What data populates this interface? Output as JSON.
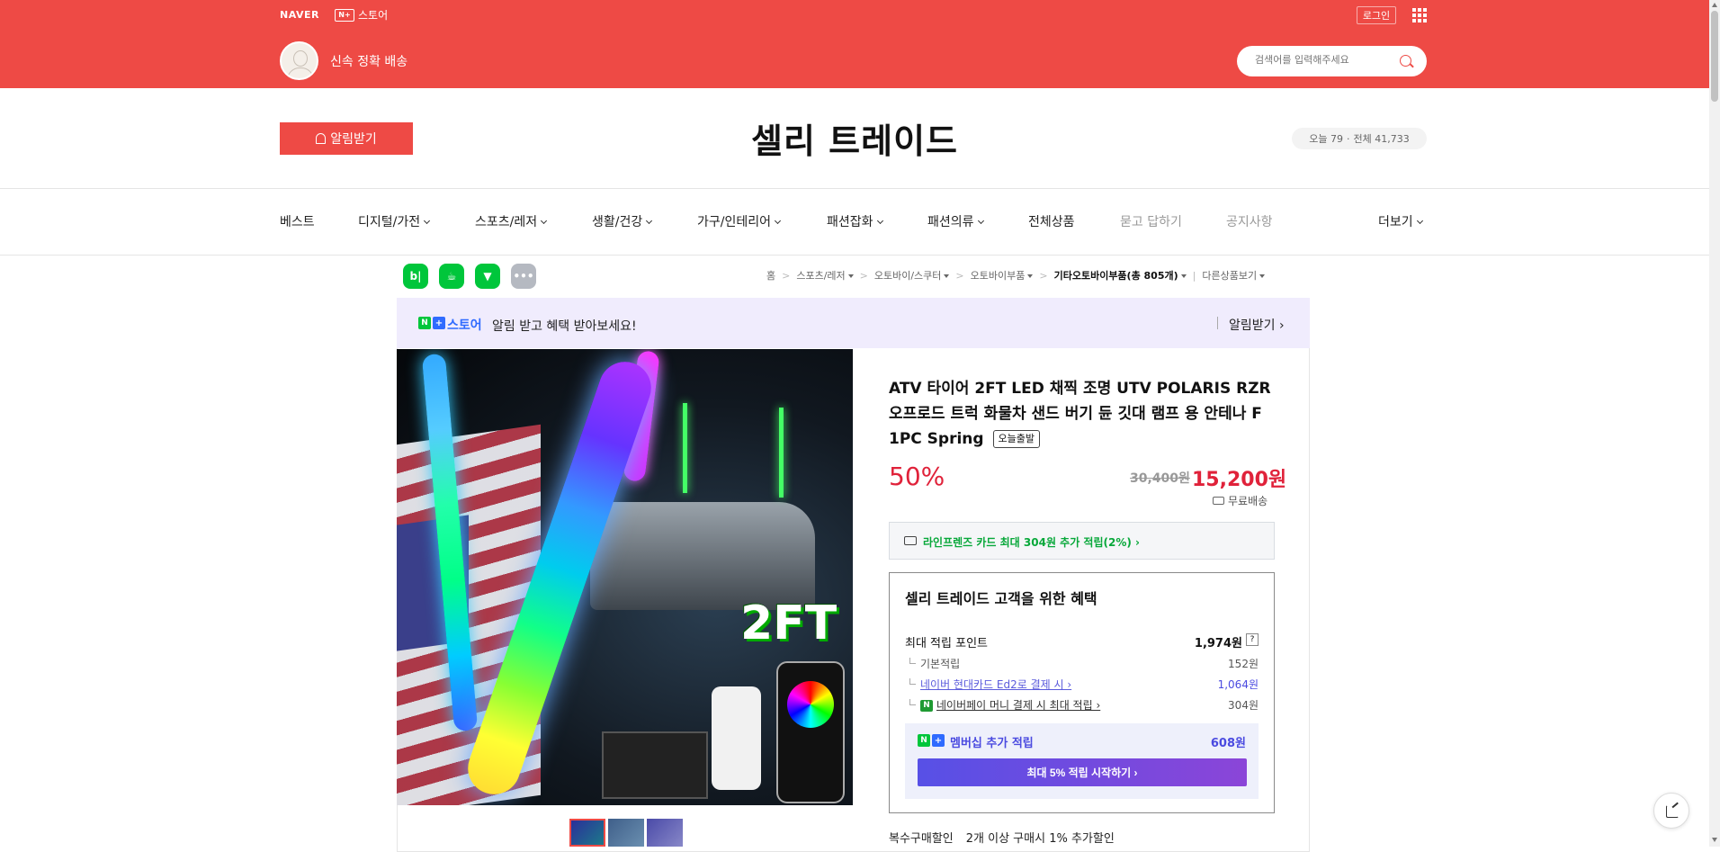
{
  "topbar": {
    "naver_label": "NAVER",
    "store_badge": "N+",
    "store_label": "스토어",
    "login_label": "로그인",
    "slogan": "신속 정확 배송",
    "search_placeholder": "검색어를 입력해주세요"
  },
  "header": {
    "alarm_label": "알림받기",
    "store_name": "셀리 트레이드",
    "visits_today": "오늘 79",
    "visits_total": "전체 41,733"
  },
  "nav": {
    "items": [
      {
        "label": "베스트"
      },
      {
        "label": "디지털/가전"
      },
      {
        "label": "스포츠/레저"
      },
      {
        "label": "생활/건강"
      },
      {
        "label": "가구/인테리어"
      },
      {
        "label": "패션잡화"
      },
      {
        "label": "패션의류"
      },
      {
        "label": "전체상품"
      },
      {
        "label": "묻고 답하기"
      },
      {
        "label": "공지사항"
      },
      {
        "label": "더보기"
      }
    ]
  },
  "social": {
    "blog_glyph": "b|",
    "more_glyph": "•••"
  },
  "breadcrumb": {
    "items": [
      "홈",
      "스포츠/레저",
      "오토바이/스쿠터",
      "오토바이부품",
      "기타오토바이부품(총 805개)",
      "다른상품보기"
    ]
  },
  "banner": {
    "badge_n": "N",
    "badge_plus": "+",
    "store_label": "스토어",
    "text": "알림 받고 혜택 받아보세요!",
    "link_label": "알림받기 ›"
  },
  "product": {
    "image_label": "2FT",
    "title": "ATV 타이어 2FT LED 채찍 조명 UTV POLARIS RZR 오프로드 트럭 화물차 샌드 버기 듄 깃대 램프 용 안테나 F 1PC Spring",
    "badge": "오늘출발",
    "discount": "50%",
    "original_price": "30,400원",
    "sale_price": "15,200원",
    "shipping": "무료배송",
    "card_offer": "라인프렌즈 카드 최대 304원 추가 적립(2%) ›"
  },
  "benefit": {
    "title": "셀리 트레이드 고객을 위한 혜택",
    "max_points_label": "최대 적립 포인트",
    "max_points_value": "1,974원",
    "help": "?",
    "basic_label": "기본적립",
    "basic_value": "152원",
    "card_label": "네이버 현대카드 Ed2로 결제 시 ›",
    "card_value": "1,064원",
    "npay_icon": "N",
    "npay_label": "네이버페이 머니 결제 시 최대 적립 ›",
    "npay_value": "304원",
    "member_label": "멤버십 추가 적립",
    "member_value": "608원",
    "member_button": "최대 5% 적립 시작하기 ›"
  },
  "multi": {
    "label": "복수구매할인",
    "text": "2개 이상 구매시 1% 추가할인"
  }
}
